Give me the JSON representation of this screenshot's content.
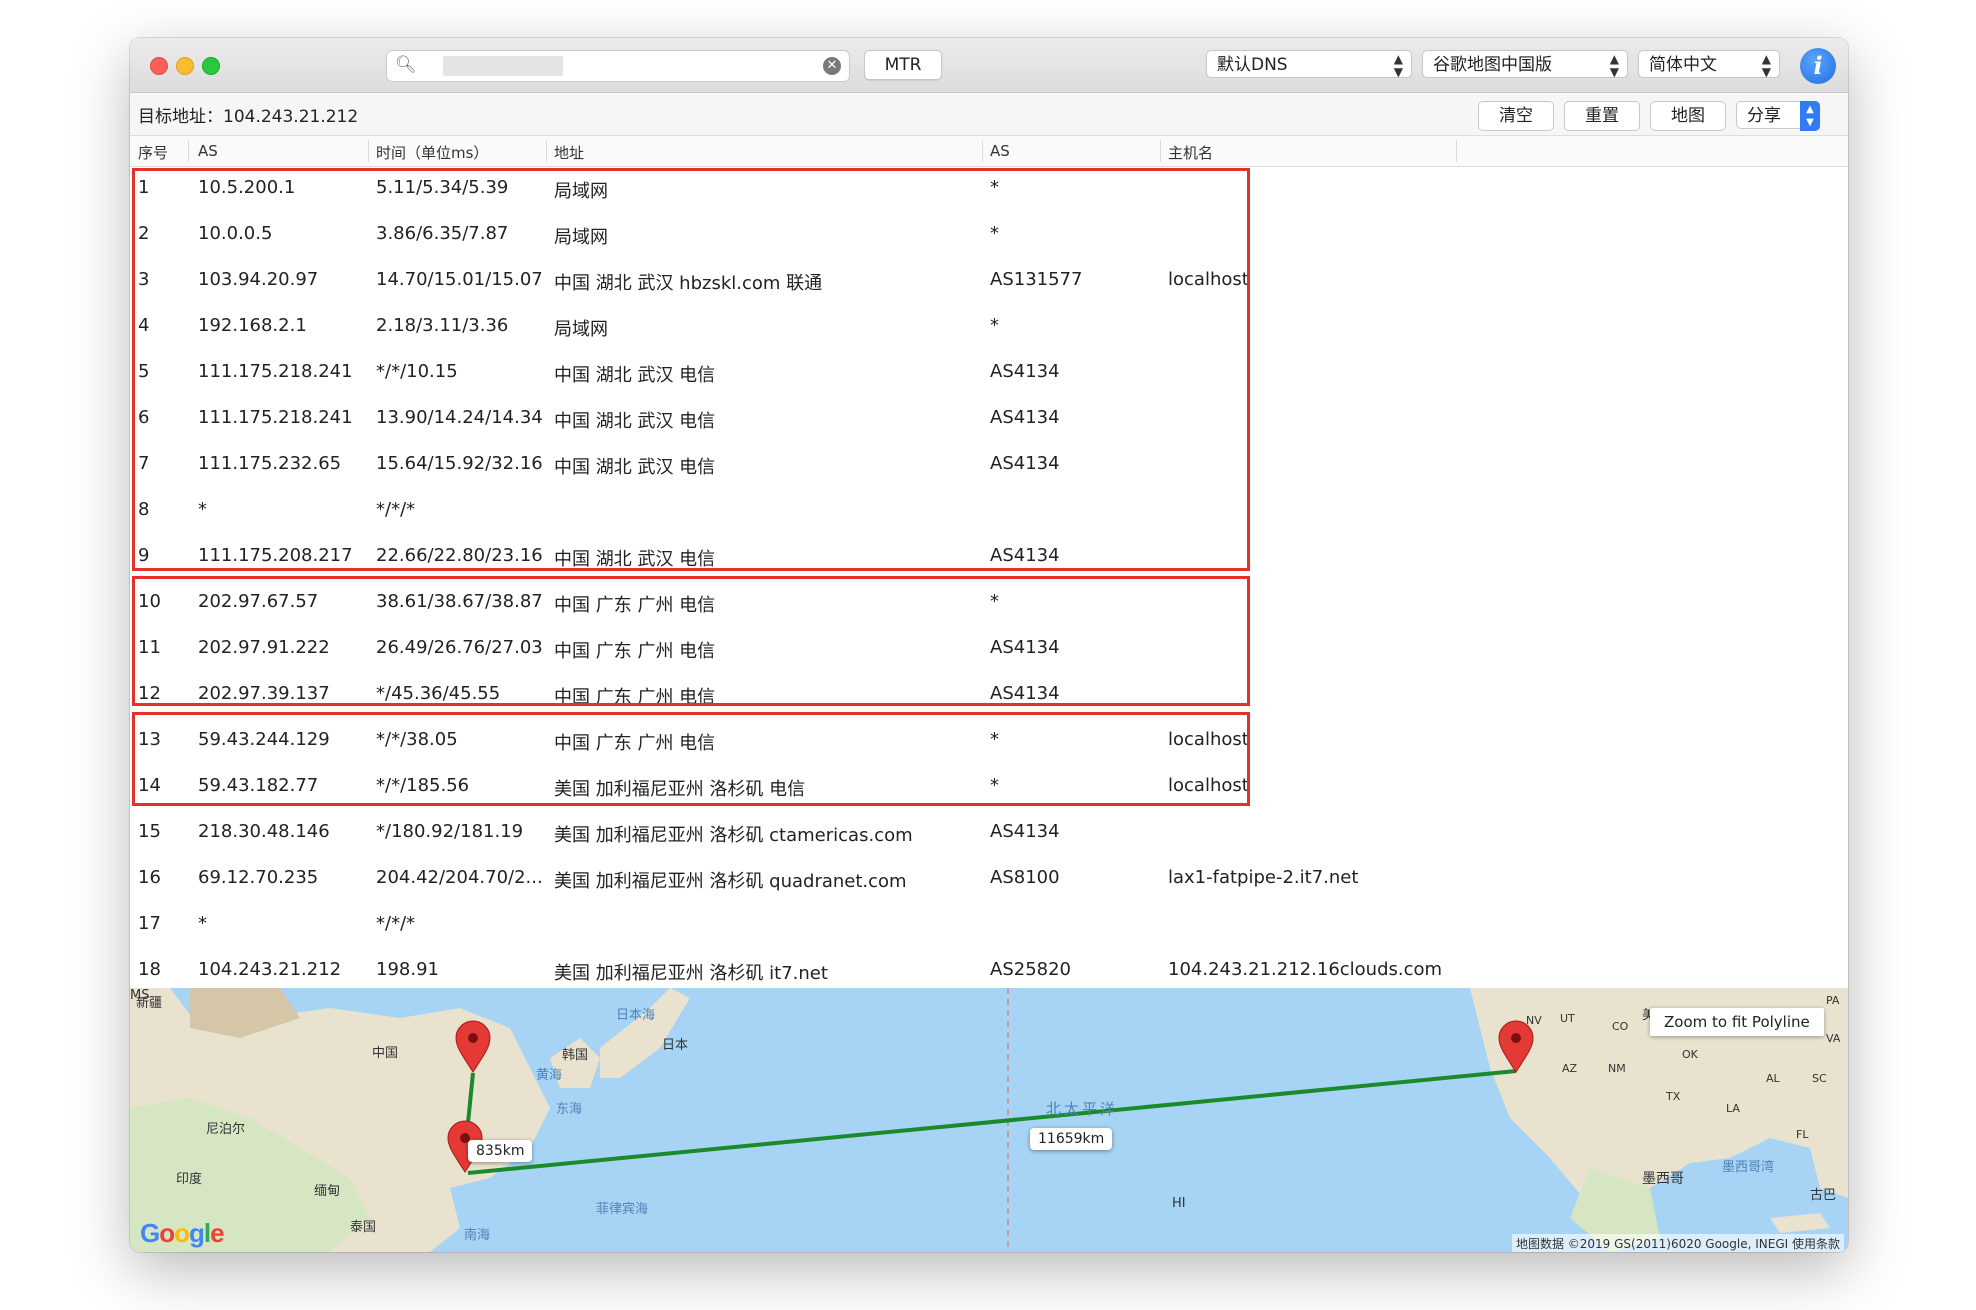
{
  "titlebar": {
    "mtr_label": "MTR",
    "dns_select": "默认DNS",
    "map_select": "谷歌地图中国版",
    "lang_select": "简体中文",
    "info_glyph": "i"
  },
  "toolbar": {
    "target": "目标地址：104.243.21.212",
    "clear_label": "清空",
    "reset_label": "重置",
    "map_label": "地图",
    "share_label": "分享"
  },
  "table": {
    "headers": [
      "序号",
      "AS",
      "时间（单位ms）",
      "地址",
      "AS",
      "主机名"
    ],
    "rows": [
      {
        "no": "1",
        "ip": "10.5.200.1",
        "time": "5.11/5.34/5.39",
        "addr": "局域网",
        "as": "*",
        "host": ""
      },
      {
        "no": "2",
        "ip": "10.0.0.5",
        "time": "3.86/6.35/7.87",
        "addr": "局域网",
        "as": "*",
        "host": ""
      },
      {
        "no": "3",
        "ip": "103.94.20.97",
        "time": "14.70/15.01/15.07",
        "addr": "中国 湖北 武汉 hbzskl.com 联通",
        "as": "AS131577",
        "host": "localhost"
      },
      {
        "no": "4",
        "ip": "192.168.2.1",
        "time": "2.18/3.11/3.36",
        "addr": "局域网",
        "as": "*",
        "host": ""
      },
      {
        "no": "5",
        "ip": "111.175.218.241",
        "time": "*/*/10.15",
        "addr": "中国 湖北 武汉 电信",
        "as": "AS4134",
        "host": ""
      },
      {
        "no": "6",
        "ip": "111.175.218.241",
        "time": "13.90/14.24/14.34",
        "addr": "中国 湖北 武汉 电信",
        "as": "AS4134",
        "host": ""
      },
      {
        "no": "7",
        "ip": "111.175.232.65",
        "time": "15.64/15.92/32.16",
        "addr": "中国 湖北 武汉 电信",
        "as": "AS4134",
        "host": ""
      },
      {
        "no": "8",
        "ip": "*",
        "time": "*/*/*",
        "addr": "",
        "as": "",
        "host": ""
      },
      {
        "no": "9",
        "ip": "111.175.208.217",
        "time": "22.66/22.80/23.16",
        "addr": "中国 湖北 武汉 电信",
        "as": "AS4134",
        "host": ""
      },
      {
        "no": "10",
        "ip": "202.97.67.57",
        "time": "38.61/38.67/38.87",
        "addr": "中国 广东 广州 电信",
        "as": "*",
        "host": ""
      },
      {
        "no": "11",
        "ip": "202.97.91.222",
        "time": "26.49/26.76/27.03",
        "addr": "中国 广东 广州 电信",
        "as": "AS4134",
        "host": ""
      },
      {
        "no": "12",
        "ip": "202.97.39.137",
        "time": "*/45.36/45.55",
        "addr": "中国 广东 广州 电信",
        "as": "AS4134",
        "host": ""
      },
      {
        "no": "13",
        "ip": "59.43.244.129",
        "time": "*/*/38.05",
        "addr": "中国 广东 广州 电信",
        "as": "*",
        "host": "localhost"
      },
      {
        "no": "14",
        "ip": "59.43.182.77",
        "time": "*/*/185.56",
        "addr": "美国 加利福尼亚州 洛杉矶 电信",
        "as": "*",
        "host": "localhost"
      },
      {
        "no": "15",
        "ip": "218.30.48.146",
        "time": "*/180.92/181.19",
        "addr": "美国 加利福尼亚州 洛杉矶 ctamericas.com",
        "as": "AS4134",
        "host": ""
      },
      {
        "no": "16",
        "ip": "69.12.70.235",
        "time": "204.42/204.70/2...",
        "addr": "美国 加利福尼亚州 洛杉矶 quadranet.com",
        "as": "AS8100",
        "host": "lax1-fatpipe-2.it7.net"
      },
      {
        "no": "17",
        "ip": "*",
        "time": "*/*/*",
        "addr": "",
        "as": "",
        "host": ""
      },
      {
        "no": "18",
        "ip": "104.243.21.212",
        "time": "198.91",
        "addr": "美国 加利福尼亚州 洛杉矶 it7.net",
        "as": "AS25820",
        "host": "104.243.21.212.16clouds.com"
      }
    ]
  },
  "map": {
    "zoom_button": "Zoom to fit Polyline",
    "distance_1": "835km",
    "distance_2": "11659km",
    "google_logo": "Google",
    "attribution": "地图数据 ©2019 GS(2011)6020 Google, INEGI   使用条款",
    "labels": {
      "china": "中国",
      "korea": "韩国",
      "japan": "日本",
      "sea_of_japan": "日本海",
      "yellow_sea": "黄海",
      "east_sea": "东海",
      "nepal": "尼泊尔",
      "india": "印度",
      "myanmar": "缅甸",
      "thailand": "泰国",
      "philippine_sea": "菲律宾海",
      "south_sea": "南海",
      "xinjiang": "新疆",
      "north_pacific": "北太平洋",
      "mexico": "墨西哥",
      "gulf_of_mexico": "墨西哥湾",
      "cuba": "古巴",
      "us_abbr": "美",
      "hi": "HI",
      "ut": "UT",
      "co": "CO",
      "az": "AZ",
      "nm": "NM",
      "tx": "TX",
      "ok": "OK",
      "ms": "MS",
      "al": "AL",
      "sc": "SC",
      "la": "LA",
      "fl": "FL",
      "va": "VA",
      "nv": "NV",
      "pa": "PA"
    },
    "colors": {
      "water": "#a7d4f5",
      "route": "#1b8a2a",
      "marker": "#e53935"
    }
  }
}
